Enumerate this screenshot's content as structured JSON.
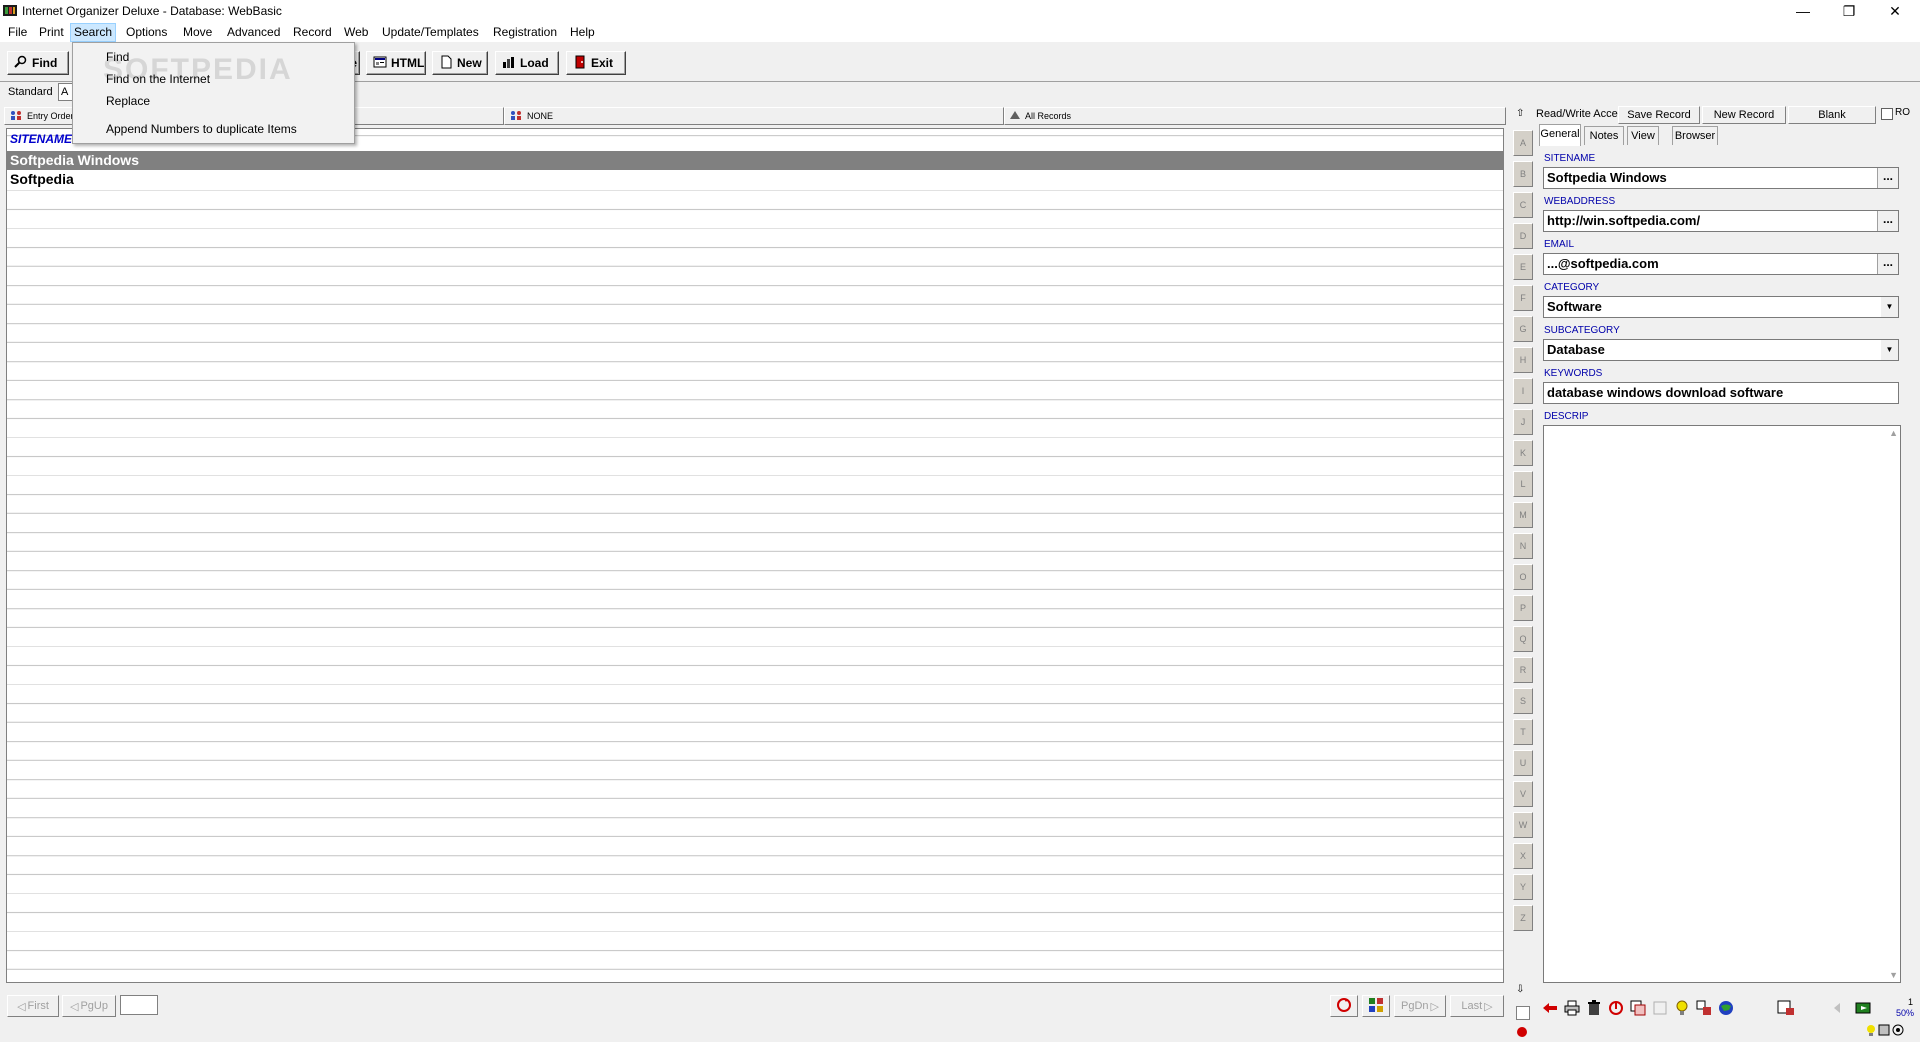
{
  "window": {
    "title": "Internet Organizer Deluxe - Database: WebBasic",
    "minimize": "—",
    "restore": "❐",
    "close": "✕"
  },
  "menu": [
    "File",
    "Print",
    "Search",
    "Options",
    "Move",
    "Advanced",
    "Record",
    "Web",
    "Update/Templates",
    "Registration",
    "Help"
  ],
  "search_menu": {
    "items": [
      "Find",
      "Find on the Internet",
      "Replace",
      "Append Numbers to duplicate Items"
    ],
    "watermark": "SOFTPEDIA"
  },
  "toolbar": {
    "find": "Find",
    "partial": "e",
    "html": "HTML",
    "new": "New",
    "load": "Load",
    "exit": "Exit"
  },
  "view": {
    "mode": "Standard",
    "selector": "A"
  },
  "columns": {
    "entry_order": "Entry Order",
    "none": "NONE",
    "all_records": "All Records"
  },
  "grid": {
    "header": "SITENAME",
    "rows": [
      "Softpedia Windows",
      "Softpedia"
    ],
    "selected_index": 0
  },
  "alphabet": [
    "A",
    "B",
    "C",
    "D",
    "E",
    "F",
    "G",
    "H",
    "I",
    "J",
    "K",
    "L",
    "M",
    "N",
    "O",
    "P",
    "Q",
    "R",
    "S",
    "T",
    "U",
    "V",
    "W",
    "X",
    "Y",
    "Z"
  ],
  "record_panel": {
    "access": "Read/Write Acce",
    "save": "Save Record",
    "new_record": "New Record",
    "blank": "Blank",
    "ro": "RO",
    "tabs": [
      "General",
      "Notes",
      "View",
      "Browser"
    ],
    "fields": {
      "sitename_label": "SITENAME",
      "sitename": "Softpedia Windows",
      "webaddress_label": "WEBADDRESS",
      "webaddress": "http://win.softpedia.com/",
      "email_label": "EMAIL",
      "email": "...@softpedia.com",
      "category_label": "CATEGORY",
      "category": "Software",
      "subcategory_label": "SUBCATEGORY",
      "subcategory": "Database",
      "keywords_label": "KEYWORDS",
      "keywords": "database windows download software",
      "descrip_label": "DESCRIP"
    },
    "zoom": "50%",
    "counter": "1"
  },
  "nav": {
    "first": "First",
    "pgup": "PgUp",
    "pgdn": "PgDn",
    "last": "Last",
    "dots": "..."
  },
  "colors": {
    "selected_row": "#808080",
    "label_blue": "#0000aa",
    "header_blue": "#0000cc"
  }
}
